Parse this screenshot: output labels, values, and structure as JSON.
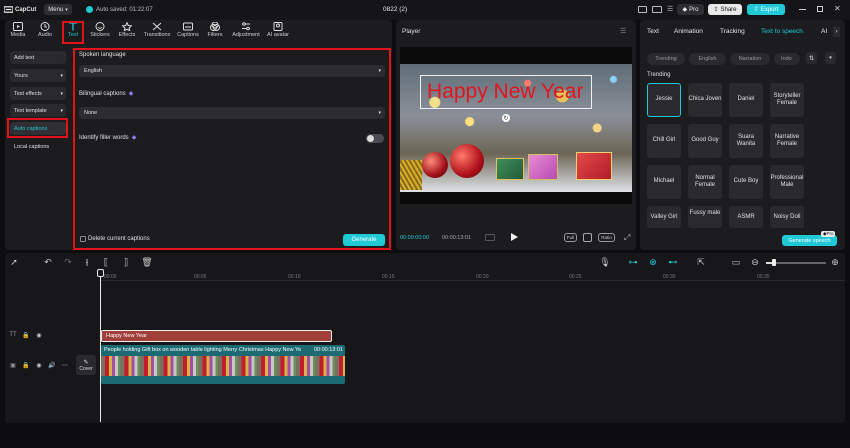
{
  "app": {
    "logo": "CapCut",
    "menu": "Menu",
    "autosave": "Auto saved: 01:22:07",
    "project": "0822 (2)",
    "pro": "Pro",
    "share": "Share",
    "export": "Export"
  },
  "toolbar": [
    {
      "label": "Media",
      "icon": "media-icon"
    },
    {
      "label": "Audio",
      "icon": "audio-icon"
    },
    {
      "label": "Text",
      "icon": "text-icon"
    },
    {
      "label": "Stickers",
      "icon": "stickers-icon"
    },
    {
      "label": "Effects",
      "icon": "effects-icon"
    },
    {
      "label": "Transitions",
      "icon": "transitions-icon"
    },
    {
      "label": "Captions",
      "icon": "captions-icon"
    },
    {
      "label": "Filters",
      "icon": "filters-icon"
    },
    {
      "label": "Adjustment",
      "icon": "adjustment-icon"
    },
    {
      "label": "AI avatar",
      "icon": "ai-avatar-icon"
    }
  ],
  "sidebar": [
    "Add text",
    "Yours",
    "Text effects",
    "Text template",
    "Auto captions",
    "Local captions"
  ],
  "captions": {
    "spoken_language_label": "Spoken language",
    "spoken_language_value": "English",
    "bilingual_label": "Bilingual captions",
    "bilingual_value": "None",
    "filler_label": "Identify filler words",
    "delete_label": "Delete current captions",
    "generate": "Generate"
  },
  "player": {
    "title": "Player",
    "overlay_text": "Happy New Year",
    "current_time": "00:00:00:00",
    "total_time": "00:00:13:01",
    "full": "Full",
    "ratio": "Ratio"
  },
  "right": {
    "tabs": [
      "Text",
      "Animation",
      "Tracking",
      "Text to speech",
      "AI"
    ],
    "filters": [
      "Trending",
      "English",
      "Narration",
      "Indo"
    ],
    "section": "Trending",
    "voices": [
      "Jessie",
      "Chica Joven",
      "Daniel",
      "Storyteller Female",
      "Chill Girl",
      "Good Guy",
      "Suara Wanita",
      "Narrative Female",
      "Michael",
      "Normal Female",
      "Cute Boy",
      "Professional Male",
      "Valley Girl",
      "Fussy male",
      "ASMR",
      "Noisy Doll"
    ],
    "generate_speech": "Generate speech",
    "pro": "Pro"
  },
  "timeline": {
    "ruler": [
      "00:00",
      "00:05",
      "00:10",
      "00:15",
      "00:20",
      "00:25",
      "00:30",
      "00:35"
    ],
    "text_clip": "Happy New Year",
    "video_clip": "People holding Gift box on wooden table lighting Merry Christmas Happy New Ye",
    "video_duration": "00:00:13:01",
    "cover": "Cover"
  },
  "colors": {
    "accent": "#1fc9d6",
    "highlight": "#e0151b",
    "text_clip": "#a13f3a",
    "video_clip": "#1c6b73"
  }
}
